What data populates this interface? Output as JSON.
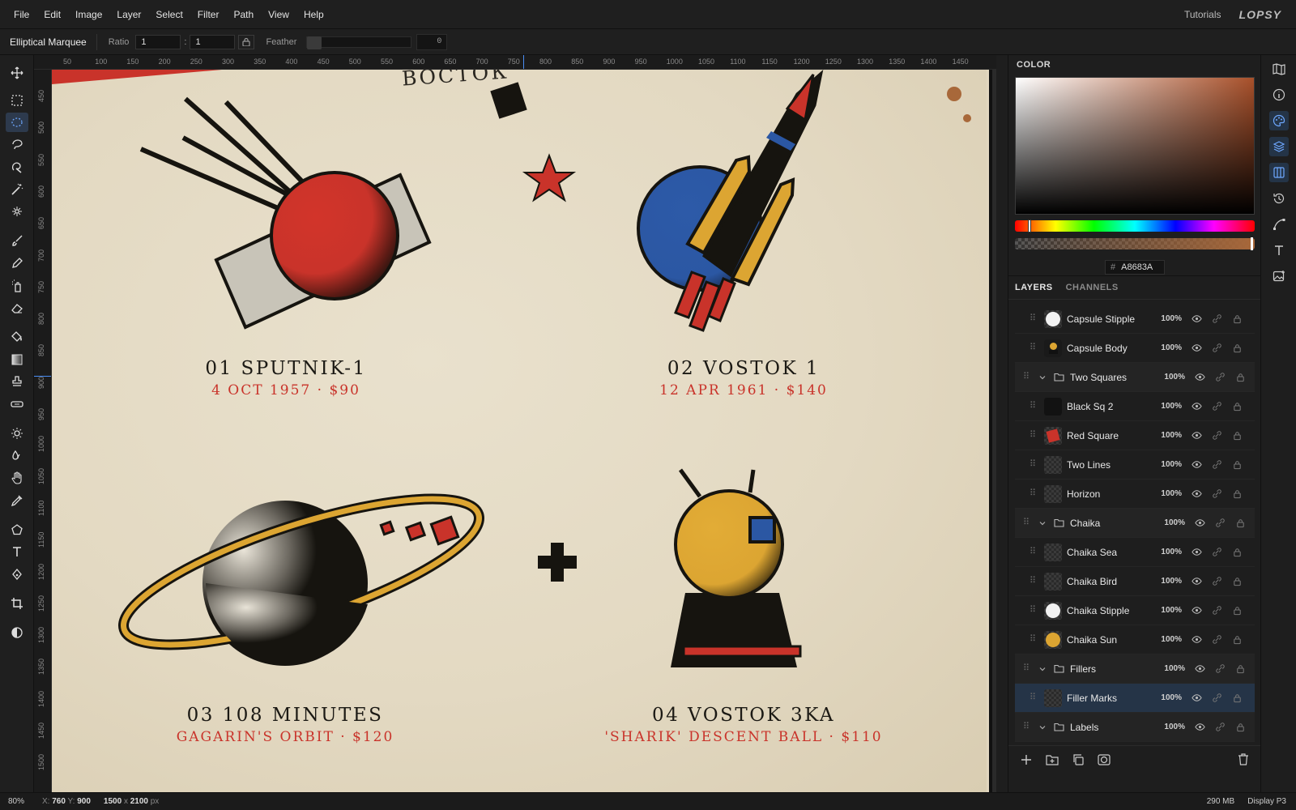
{
  "menu": [
    "File",
    "Edit",
    "Image",
    "Layer",
    "Select",
    "Filter",
    "Path",
    "View",
    "Help"
  ],
  "header": {
    "tutorials": "Tutorials",
    "brand": "LOPSY"
  },
  "options": {
    "tool_name": "Elliptical Marquee",
    "ratio_label": "Ratio",
    "ratio_a": "1",
    "ratio_sep": ":",
    "ratio_b": "1",
    "feather_label": "Feather",
    "feather_value": "0"
  },
  "ruler": {
    "top": [
      "50",
      "100",
      "150",
      "200",
      "250",
      "300",
      "350",
      "400",
      "450",
      "500",
      "550",
      "600",
      "650",
      "700",
      "750",
      "800",
      "850",
      "900",
      "950",
      "1000",
      "1050",
      "1100",
      "1150",
      "1200",
      "1250",
      "1300",
      "1350",
      "1400",
      "1450"
    ],
    "left": [
      "450",
      "500",
      "550",
      "600",
      "650",
      "700",
      "750",
      "800",
      "850",
      "900",
      "950",
      "1000",
      "1050",
      "1100",
      "1150",
      "1200",
      "1250",
      "1300",
      "1350",
      "1400",
      "1450",
      "1500"
    ]
  },
  "poster": {
    "top_word": "ВОСТОК",
    "items": [
      {
        "title": "01  SPUTNIK-1",
        "sub": "4 OCT 1957  ·  $90"
      },
      {
        "title": "02  VOSTOK 1",
        "sub": "12 APR 1961  ·  $140"
      },
      {
        "title": "03  108 MINUTES",
        "sub": "GAGARIN'S ORBIT  ·  $120"
      },
      {
        "title": "04  VOSTOK 3KA",
        "sub": "'SHARIK' DESCENT BALL  ·  $110"
      }
    ],
    "colors": {
      "paper": "#e6dcc6",
      "red": "#c9332a",
      "ink": "#16140f",
      "blue": "#2b57a3",
      "gold": "#dca532",
      "gray": "#c8c4b8"
    }
  },
  "color_panel": {
    "tab": "COLOR",
    "hex": "A8683A",
    "hex_prefix": "#"
  },
  "layers_panel": {
    "tabs": [
      "LAYERS",
      "CHANNELS"
    ],
    "layers": [
      {
        "name": "Capsule Stipple",
        "opacity": "100%",
        "type": "layer",
        "thumb": "white-blob"
      },
      {
        "name": "Capsule Body",
        "opacity": "100%",
        "type": "layer",
        "thumb": "capsule"
      },
      {
        "name": "Two Squares",
        "opacity": "100%",
        "type": "group"
      },
      {
        "name": "Black Sq 2",
        "opacity": "100%",
        "type": "layer",
        "thumb": "black"
      },
      {
        "name": "Red Square",
        "opacity": "100%",
        "type": "layer",
        "thumb": "red"
      },
      {
        "name": "Two Lines",
        "opacity": "100%",
        "type": "layer",
        "thumb": "transparent"
      },
      {
        "name": "Horizon",
        "opacity": "100%",
        "type": "layer",
        "thumb": "transparent"
      },
      {
        "name": "Chaika",
        "opacity": "100%",
        "type": "group"
      },
      {
        "name": "Chaika Sea",
        "opacity": "100%",
        "type": "layer",
        "thumb": "transparent"
      },
      {
        "name": "Chaika Bird",
        "opacity": "100%",
        "type": "layer",
        "thumb": "transparent"
      },
      {
        "name": "Chaika Stipple",
        "opacity": "100%",
        "type": "layer",
        "thumb": "white-blob"
      },
      {
        "name": "Chaika Sun",
        "opacity": "100%",
        "type": "layer",
        "thumb": "gold"
      },
      {
        "name": "Fillers",
        "opacity": "100%",
        "type": "group"
      },
      {
        "name": "Filler Marks",
        "opacity": "100%",
        "type": "layer",
        "thumb": "transparent",
        "selected": true
      },
      {
        "name": "Labels",
        "opacity": "100%",
        "type": "group"
      }
    ]
  },
  "status": {
    "zoom": "80%",
    "x_label": "X:",
    "x": "760",
    "y_label": "Y:",
    "y": "900",
    "doc_w": "1500",
    "doc_x": "x",
    "doc_h": "2100",
    "doc_unit": "px",
    "memory": "290 MB",
    "profile": "Display P3"
  }
}
